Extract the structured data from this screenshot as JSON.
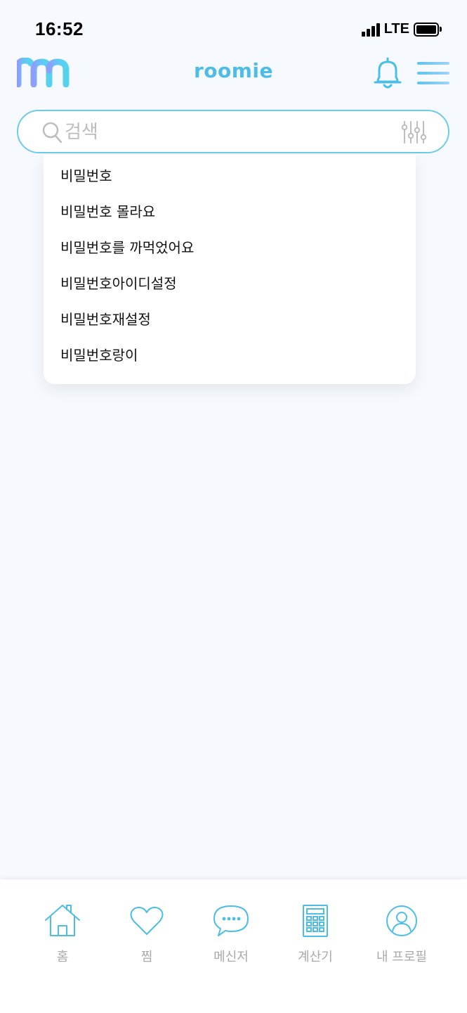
{
  "status_bar": {
    "time": "16:52",
    "network": "LTE"
  },
  "header": {
    "title": "roomie"
  },
  "search": {
    "placeholder": "검색",
    "value": ""
  },
  "suggestions": [
    "비밀번호",
    "비밀번호 몰라요",
    "비밀번호를 까먹었어요",
    "비밀번호아이디설정",
    "비밀번호재설정",
    "비밀번호랑이"
  ],
  "bottom_nav": {
    "items": [
      {
        "label": "홈",
        "icon": "home-icon"
      },
      {
        "label": "찜",
        "icon": "heart-icon"
      },
      {
        "label": "메신저",
        "icon": "chat-icon"
      },
      {
        "label": "계산기",
        "icon": "calculator-icon"
      },
      {
        "label": "내 프로필",
        "icon": "profile-icon"
      }
    ]
  },
  "colors": {
    "accent": "#4dbde6",
    "background": "#f6faff",
    "nav_label": "#a9a9a9",
    "search_border": "#6dcbea"
  }
}
